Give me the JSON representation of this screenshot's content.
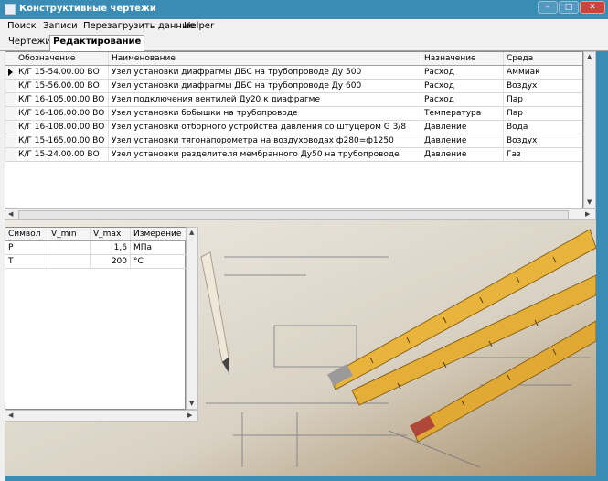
{
  "window": {
    "title": "Конструктивные чертежи"
  },
  "menu": [
    "Поиск",
    "Записи",
    "Перезагрузить данные",
    "Helper"
  ],
  "tabs": [
    {
      "label": "Чертежи",
      "active": false
    },
    {
      "label": "Редактирование",
      "active": true
    }
  ],
  "main_table": {
    "headers": [
      "Обозначение",
      "Наименование",
      "Назначение",
      "Среда"
    ],
    "rows": [
      [
        "К/Г 15-54.00.00 ВО",
        "Узел установки диафрагмы ДБС на трубопроводе Ду 500",
        "Расход",
        "Аммиак"
      ],
      [
        "К/Г 15-56.00.00 ВО",
        "Узел установки диафрагмы ДБС на трубопроводе Ду 600",
        "Расход",
        "Воздух"
      ],
      [
        "К/Г 16-105.00.00 ВО",
        "Узел подключения вентилей Ду20 к диафрагме",
        "Расход",
        "Пар"
      ],
      [
        "К/Г 16-106.00.00 ВО",
        "Узел установки бобышки на трубопроводе",
        "Температура",
        "Пар"
      ],
      [
        "К/Г 16-108.00.00 ВО",
        "Узел установки отборного устройства давления со штуцером G 3/8",
        "Давление",
        "Вода"
      ],
      [
        "К/Г 15-165.00.00 ВО",
        "Узел установки тягонапорометра на воздуховодах ф280=ф1250",
        "Давление",
        "Воздух"
      ],
      [
        "К/Г 15-24.00.00 ВО",
        "Узел установки разделителя мембранного Ду50 на трубопроводе",
        "Давление",
        "Газ"
      ]
    ],
    "selected_row": 0
  },
  "params_table": {
    "headers": [
      "Символ",
      "V_min",
      "V_max",
      "Измерение"
    ],
    "rows": [
      [
        "P",
        "",
        "1,6",
        "МПа"
      ],
      [
        "T",
        "",
        "200",
        "°C"
      ]
    ]
  },
  "colors": {
    "titlebar": "#3a8cb4",
    "ruler": "#e8b43c",
    "paper": "#e9e6df"
  },
  "icons": [
    "app-icon",
    "minimize-icon",
    "maximize-icon",
    "close-icon",
    "row-pointer-icon",
    "scroll-up-icon",
    "scroll-down-icon",
    "scroll-left-icon",
    "scroll-right-icon"
  ]
}
